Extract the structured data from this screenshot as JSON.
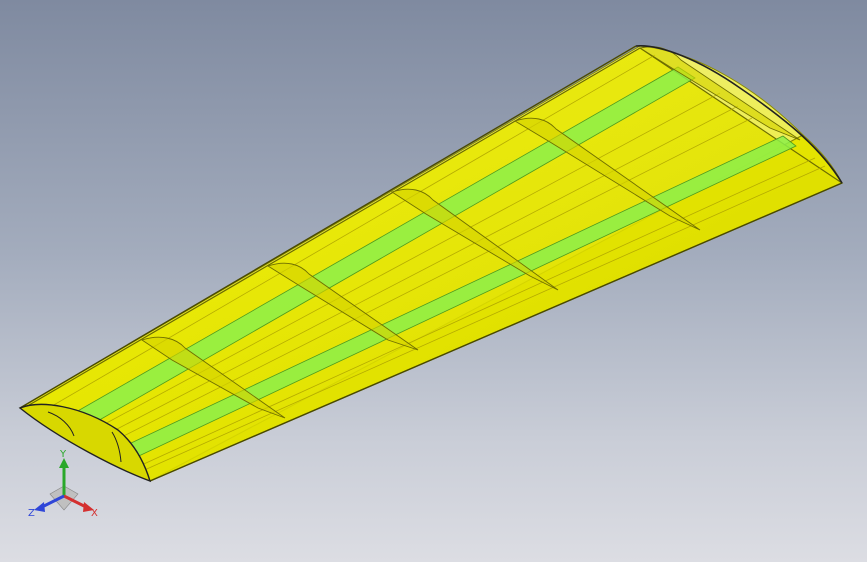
{
  "viewport": {
    "background_top": "#7f8aa0",
    "background_bottom": "#dcdde3"
  },
  "model": {
    "part": "wing",
    "skin_color": "#e6e600",
    "skin_edge_color": "#8a8a00",
    "spar_color": "#8cf04a",
    "rib_color": "#c9c800",
    "rib_count": 5,
    "spar_count": 2
  },
  "triad": {
    "x_label": "X",
    "y_label": "Y",
    "z_label": "Z",
    "x_color": "#d43030",
    "y_color": "#2aa82a",
    "z_color": "#2f46d8"
  }
}
